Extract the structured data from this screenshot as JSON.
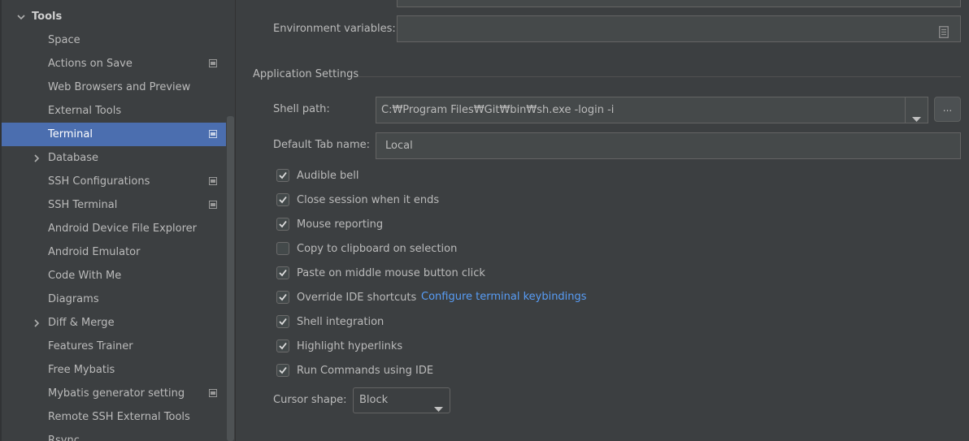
{
  "sidebar": {
    "root": {
      "label": "Tools",
      "expanded": true
    },
    "items": [
      {
        "label": "Space",
        "has_badge": false,
        "expandable": false,
        "selected": false
      },
      {
        "label": "Actions on Save",
        "has_badge": true,
        "expandable": false,
        "selected": false
      },
      {
        "label": "Web Browsers and Preview",
        "has_badge": false,
        "expandable": false,
        "selected": false
      },
      {
        "label": "External Tools",
        "has_badge": false,
        "expandable": false,
        "selected": false
      },
      {
        "label": "Terminal",
        "has_badge": true,
        "expandable": false,
        "selected": true
      },
      {
        "label": "Database",
        "has_badge": false,
        "expandable": true,
        "selected": false
      },
      {
        "label": "SSH Configurations",
        "has_badge": true,
        "expandable": false,
        "selected": false
      },
      {
        "label": "SSH Terminal",
        "has_badge": true,
        "expandable": false,
        "selected": false
      },
      {
        "label": "Android Device File Explorer",
        "has_badge": false,
        "expandable": false,
        "selected": false
      },
      {
        "label": "Android Emulator",
        "has_badge": false,
        "expandable": false,
        "selected": false
      },
      {
        "label": "Code With Me",
        "has_badge": false,
        "expandable": false,
        "selected": false
      },
      {
        "label": "Diagrams",
        "has_badge": false,
        "expandable": false,
        "selected": false
      },
      {
        "label": "Diff & Merge",
        "has_badge": false,
        "expandable": true,
        "selected": false
      },
      {
        "label": "Features Trainer",
        "has_badge": false,
        "expandable": false,
        "selected": false
      },
      {
        "label": "Free Mybatis",
        "has_badge": false,
        "expandable": false,
        "selected": false
      },
      {
        "label": "Mybatis generator setting",
        "has_badge": true,
        "expandable": false,
        "selected": false
      },
      {
        "label": "Remote SSH External Tools",
        "has_badge": false,
        "expandable": false,
        "selected": false
      },
      {
        "label": "Rsync",
        "has_badge": false,
        "expandable": false,
        "selected": false
      }
    ]
  },
  "content": {
    "env_vars": {
      "label": "Environment variables:",
      "value": ""
    },
    "section_title": "Application Settings",
    "shell_path": {
      "label": "Shell path:",
      "value": "C:₩Program Files₩Git₩bin₩sh.exe -login -i",
      "browse_label": "..."
    },
    "default_tab": {
      "label": "Default Tab name:",
      "value": "Local"
    },
    "options": [
      {
        "label": "Audible bell",
        "checked": true
      },
      {
        "label": "Close session when it ends",
        "checked": true
      },
      {
        "label": "Mouse reporting",
        "checked": true
      },
      {
        "label": "Copy to clipboard on selection",
        "checked": false
      },
      {
        "label": "Paste on middle mouse button click",
        "checked": true
      },
      {
        "label": "Override IDE shortcuts",
        "checked": true
      },
      {
        "label": "Shell integration",
        "checked": true
      },
      {
        "label": "Highlight hyperlinks",
        "checked": true
      },
      {
        "label": "Run Commands using IDE",
        "checked": true
      }
    ],
    "configure_link": "Configure terminal keybindings",
    "cursor_shape": {
      "label": "Cursor shape:",
      "value": "Block"
    }
  },
  "colors": {
    "background": "#3c3f41",
    "selection": "#4b6eaf",
    "link": "#589df6",
    "field_background": "#45494a"
  },
  "icons": {
    "expand": "chevron-down-icon",
    "collapsed": "chevron-right-icon",
    "badge": "project-scope-icon",
    "checkmark": "checkmark-icon",
    "dropdown": "caret-down-icon",
    "file": "file-list-icon"
  }
}
